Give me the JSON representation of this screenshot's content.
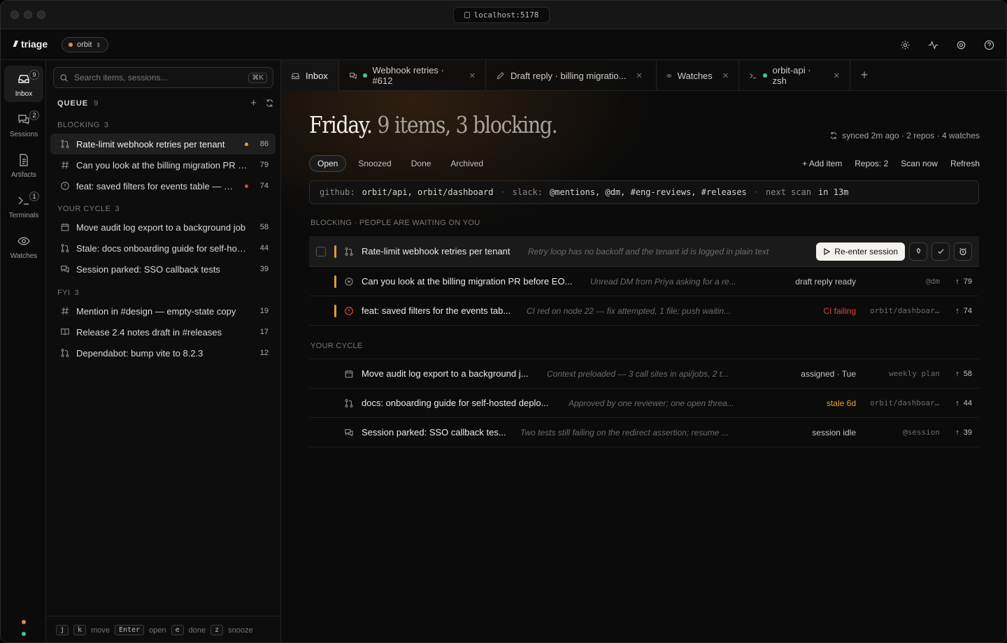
{
  "browser": {
    "url": "localhost:5178"
  },
  "app": {
    "name": "triage",
    "workspace": "orbit"
  },
  "rail": [
    {
      "label": "Inbox",
      "badge": "9",
      "icon": "inbox-icon"
    },
    {
      "label": "Sessions",
      "badge": "2",
      "icon": "chat-icon"
    },
    {
      "label": "Artifacts",
      "badge": "",
      "icon": "document-icon"
    },
    {
      "label": "Terminals",
      "badge": "1",
      "icon": "terminal-icon"
    },
    {
      "label": "Watches",
      "badge": "",
      "icon": "eye-icon"
    }
  ],
  "sidebar": {
    "search_placeholder": "Search items, sessions...",
    "search_shortcut": "⌘K",
    "queue_title": "QUEUE",
    "queue_count": "9",
    "groups": [
      {
        "label": "BLOCKING",
        "count": "3",
        "items": [
          {
            "text": "Rate-limit webhook retries per tenant",
            "num": "86",
            "icon": "pull-request-icon",
            "dot": "#e3a33a"
          },
          {
            "text": "Can you look at the billing migration PR b...",
            "num": "79",
            "icon": "hash-icon",
            "dot": ""
          },
          {
            "text": "feat: saved filters for events table — CI ...",
            "num": "74",
            "icon": "alert-circle-icon",
            "dot": "#e0453b"
          }
        ]
      },
      {
        "label": "YOUR CYCLE",
        "count": "3",
        "items": [
          {
            "text": "Move audit log export to a background job",
            "num": "58",
            "icon": "calendar-icon",
            "dot": ""
          },
          {
            "text": "Stale: docs onboarding guide for self-hos...",
            "num": "44",
            "icon": "pull-request-icon",
            "dot": ""
          },
          {
            "text": "Session parked: SSO callback tests",
            "num": "39",
            "icon": "chat-icon",
            "dot": ""
          }
        ]
      },
      {
        "label": "FYI",
        "count": "3",
        "items": [
          {
            "text": "Mention in #design — empty-state copy",
            "num": "19",
            "icon": "hash-icon",
            "dot": ""
          },
          {
            "text": "Release 2.4 notes draft in #releases",
            "num": "17",
            "icon": "book-icon",
            "dot": ""
          },
          {
            "text": "Dependabot: bump vite to 8.2.3",
            "num": "12",
            "icon": "pull-request-icon",
            "dot": ""
          }
        ]
      }
    ],
    "footer": {
      "k1": "j",
      "k2": "k",
      "move": "move",
      "k3": "Enter",
      "open": "open",
      "k4": "e",
      "done": "done",
      "k5": "z",
      "snooze": "snooze"
    }
  },
  "tabs": [
    {
      "label": "Inbox",
      "icon": "inbox-icon",
      "dot": "",
      "closable": false
    },
    {
      "label": "Webhook retries · #612",
      "icon": "chat-icon",
      "dot": "#3ec98a",
      "closable": true
    },
    {
      "label": "Draft reply · billing migratio...",
      "icon": "pencil-icon",
      "dot": "",
      "closable": true
    },
    {
      "label": "Watches",
      "icon": "eye-icon",
      "dot": "",
      "closable": true
    },
    {
      "label": "orbit-api · zsh",
      "icon": "terminal-icon",
      "dot": "#3ec98a",
      "closable": true
    }
  ],
  "main": {
    "headline_day": "Friday.",
    "headline_rest": "9 items, 3 blocking.",
    "sync": "synced 2m ago · 2 repos · 4 watches",
    "filters": [
      "Open",
      "Snoozed",
      "Done",
      "Archived"
    ],
    "active_filter": "Open",
    "actions": [
      "+ Add item",
      "Repos: 2",
      "Scan now",
      "Refresh"
    ],
    "sources": {
      "github_label": "github:",
      "github_val": "orbit/api, orbit/dashboard",
      "slack_label": "slack:",
      "slack_val": "@mentions, @dm, #eng-reviews, #releases",
      "next_label": "next scan",
      "next_val": "in 13m"
    },
    "blocking_label": "BLOCKING · PEOPLE ARE WAITING ON YOU",
    "cycle_label": "YOUR CYCLE",
    "blocking": [
      {
        "title": "Rate-limit webhook retries per tenant",
        "desc": "Retry loop has no backoff and the tenant id is logged in plain text",
        "primary": "Re-enter session"
      },
      {
        "title": "Can you look at the billing migration PR before EO...",
        "desc": "Unread DM from Priya asking for a re...",
        "status": "draft reply ready",
        "source": "@dm",
        "score": "79"
      },
      {
        "title": "feat: saved filters for the events tab...",
        "desc": "CI red on node 22 — fix attempted, 1 file; push waitin...",
        "status": "CI failing",
        "source": "orbit/dashboar...",
        "score": "74"
      }
    ],
    "cycle": [
      {
        "title": "Move audit log export to a background j...",
        "desc": "Context preloaded — 3 call sites in api/jobs, 2 t...",
        "status": "assigned · Tue",
        "source": "weekly plan",
        "score": "58"
      },
      {
        "title": "docs: onboarding guide for self-hosted deplo...",
        "desc": "Approved by one reviewer; one open threa...",
        "status": "stale 6d",
        "source": "orbit/dashboar...",
        "score": "44"
      },
      {
        "title": "Session parked: SSO callback tes...",
        "desc": "Two tests still failing on the redirect assertion; resume ...",
        "status": "session idle",
        "source": "@session",
        "score": "39"
      }
    ]
  },
  "colors": {
    "accent": "#e09a3b",
    "danger": "#e0453b",
    "ok": "#3ec98a",
    "stale": "#e3a33a"
  }
}
